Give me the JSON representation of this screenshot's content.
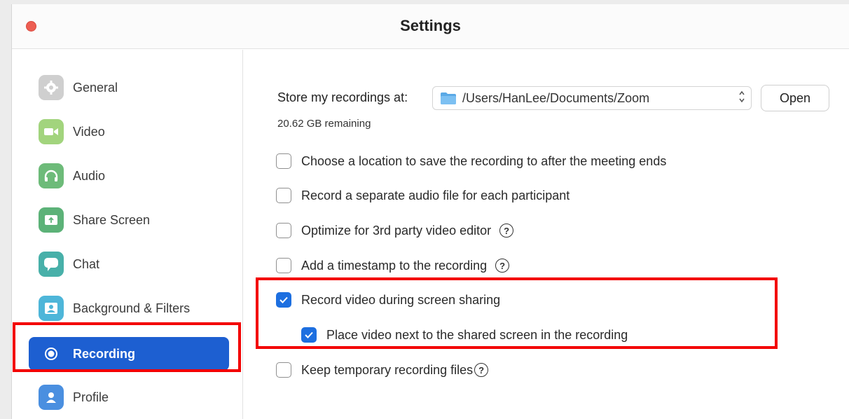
{
  "window": {
    "title": "Settings"
  },
  "sidebar": {
    "items": [
      {
        "label": "General",
        "icon": "gear-icon",
        "color": "#c9c9c9"
      },
      {
        "label": "Video",
        "icon": "video-camera-icon",
        "color": "#9fd37a"
      },
      {
        "label": "Audio",
        "icon": "headphones-icon",
        "color": "#6dbb79"
      },
      {
        "label": "Share Screen",
        "icon": "share-screen-icon",
        "color": "#5cb278"
      },
      {
        "label": "Chat",
        "icon": "chat-bubble-icon",
        "color": "#48b0a9"
      },
      {
        "label": "Background & Filters",
        "icon": "person-background-icon",
        "color": "#4eb6d9"
      },
      {
        "label": "Recording",
        "icon": "record-icon",
        "color": "#1d5fd1",
        "active": true
      },
      {
        "label": "Profile",
        "icon": "profile-icon",
        "color": "#4a8fe0"
      }
    ]
  },
  "recording": {
    "store_label": "Store my recordings at:",
    "path": "/Users/HanLee/Documents/Zoom",
    "open_button": "Open",
    "remaining": "20.62 GB remaining",
    "options": [
      {
        "label": "Choose a location to save the recording to after the meeting ends",
        "checked": false
      },
      {
        "label": "Record a separate audio file for each participant",
        "checked": false
      },
      {
        "label": "Optimize for 3rd party video editor",
        "checked": false,
        "help": true
      },
      {
        "label": "Add a timestamp to the recording",
        "checked": false,
        "help": true
      },
      {
        "label": "Record video during screen sharing",
        "checked": true
      },
      {
        "label": "Place video next to the shared screen in the recording",
        "checked": true,
        "indented": true
      },
      {
        "label": "Keep temporary recording files",
        "checked": false,
        "help": true
      }
    ],
    "help_glyph": "?"
  },
  "colors": {
    "accent": "#1d5fd1",
    "highlight": "#f30000",
    "checkbox": "#1d6fe0"
  }
}
